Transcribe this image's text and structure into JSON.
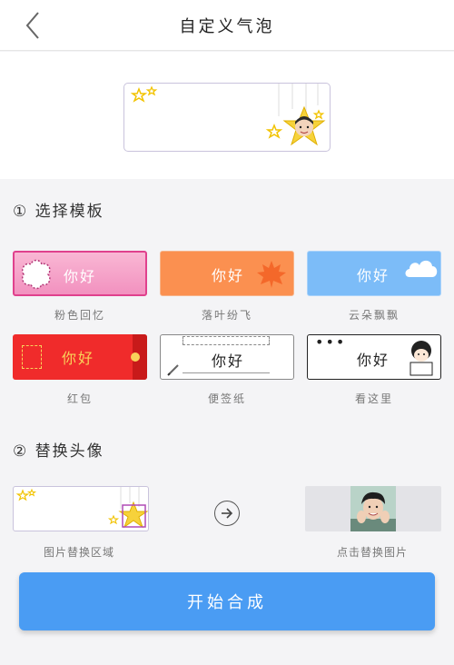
{
  "header": {
    "title": "自定义气泡",
    "back_icon": "chevron-left-icon"
  },
  "colors": {
    "accent": "#4a9cf3",
    "pink": "#f7a3c9",
    "orange": "#fb9050",
    "sky": "#7cbcf8",
    "red": "#f02b2b"
  },
  "sections": {
    "choose_template": "① 选择模板",
    "replace_avatar": "② 替换头像"
  },
  "templates": [
    {
      "id": "pink",
      "label": "粉色回忆",
      "text": "你好",
      "selected": true
    },
    {
      "id": "leaves",
      "label": "落叶纷飞",
      "text": "你好",
      "selected": false
    },
    {
      "id": "clouds",
      "label": "云朵飘飘",
      "text": "你好",
      "selected": false
    },
    {
      "id": "redpacket",
      "label": "红包",
      "text": "你好",
      "selected": false
    },
    {
      "id": "notepaper",
      "label": "便签纸",
      "text": "你好",
      "selected": false
    },
    {
      "id": "lookhere",
      "label": "看这里",
      "text": "你好",
      "selected": false
    }
  ],
  "avatar": {
    "left_caption": "图片替换区域",
    "right_caption": "点击替换图片",
    "arrow_icon": "arrow-right-icon"
  },
  "start_button": "开始合成"
}
